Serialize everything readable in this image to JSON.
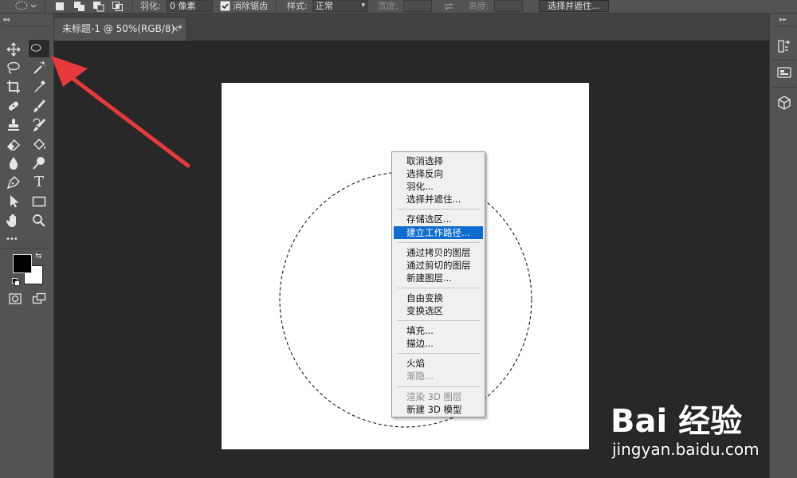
{
  "options_bar": {
    "feather_label": "羽化:",
    "feather_value": "0 像素",
    "antialias_label": "消除锯齿",
    "antialias_checked": true,
    "style_label": "样式:",
    "style_value": "正常",
    "width_label": "宽度:",
    "height_label": "高度:",
    "select_mask_button": "选择并遮住..."
  },
  "document_tab": {
    "title": "未标题-1 @ 50%(RGB/8) *",
    "close_glyph": "×"
  },
  "colors": {
    "foreground": "#000000",
    "background": "#ffffff",
    "menu_highlight": "#0c6ccf",
    "arrow": "#e8393a"
  },
  "toolbar": {
    "tools": [
      "move-icon",
      "elliptical-marquee-icon",
      "lasso-icon",
      "magic-wand-icon",
      "crop-icon",
      "eyedropper-icon",
      "healing-brush-icon",
      "brush-icon",
      "clone-stamp-icon",
      "history-brush-icon",
      "eraser-icon",
      "paint-bucket-icon",
      "blur-icon",
      "dodge-icon",
      "pen-icon",
      "type-icon",
      "path-selection-icon",
      "rectangle-icon",
      "hand-icon",
      "zoom-icon"
    ],
    "active_tool": "elliptical-marquee-icon",
    "type_tool_glyph": "T",
    "more_glyph": "•••"
  },
  "context_menu": {
    "groups": [
      [
        {
          "label": "取消选择",
          "state": "normal"
        },
        {
          "label": "选择反向",
          "state": "normal"
        },
        {
          "label": "羽化...",
          "state": "normal"
        },
        {
          "label": "选择并遮住...",
          "state": "normal"
        }
      ],
      [
        {
          "label": "存储选区...",
          "state": "normal"
        },
        {
          "label": "建立工作路径...",
          "state": "highlighted"
        }
      ],
      [
        {
          "label": "通过拷贝的图层",
          "state": "normal"
        },
        {
          "label": "通过剪切的图层",
          "state": "normal"
        },
        {
          "label": "新建图层...",
          "state": "normal"
        }
      ],
      [
        {
          "label": "自由变换",
          "state": "normal"
        },
        {
          "label": "变换选区",
          "state": "normal"
        }
      ],
      [
        {
          "label": "填充...",
          "state": "normal"
        },
        {
          "label": "描边...",
          "state": "normal"
        }
      ],
      [
        {
          "label": "火焰",
          "state": "normal"
        },
        {
          "label": "渐隐...",
          "state": "disabled"
        }
      ],
      [
        {
          "label": "渲染 3D 图层",
          "state": "disabled"
        },
        {
          "label": "新建 3D 模型",
          "state": "normal"
        }
      ]
    ]
  },
  "right_dock": {
    "icons": [
      "history-icon",
      "libraries-icon",
      "3d-cube-icon"
    ]
  },
  "watermark": {
    "logo_text": "Bai 经验",
    "url": "jingyan.baidu.com"
  }
}
